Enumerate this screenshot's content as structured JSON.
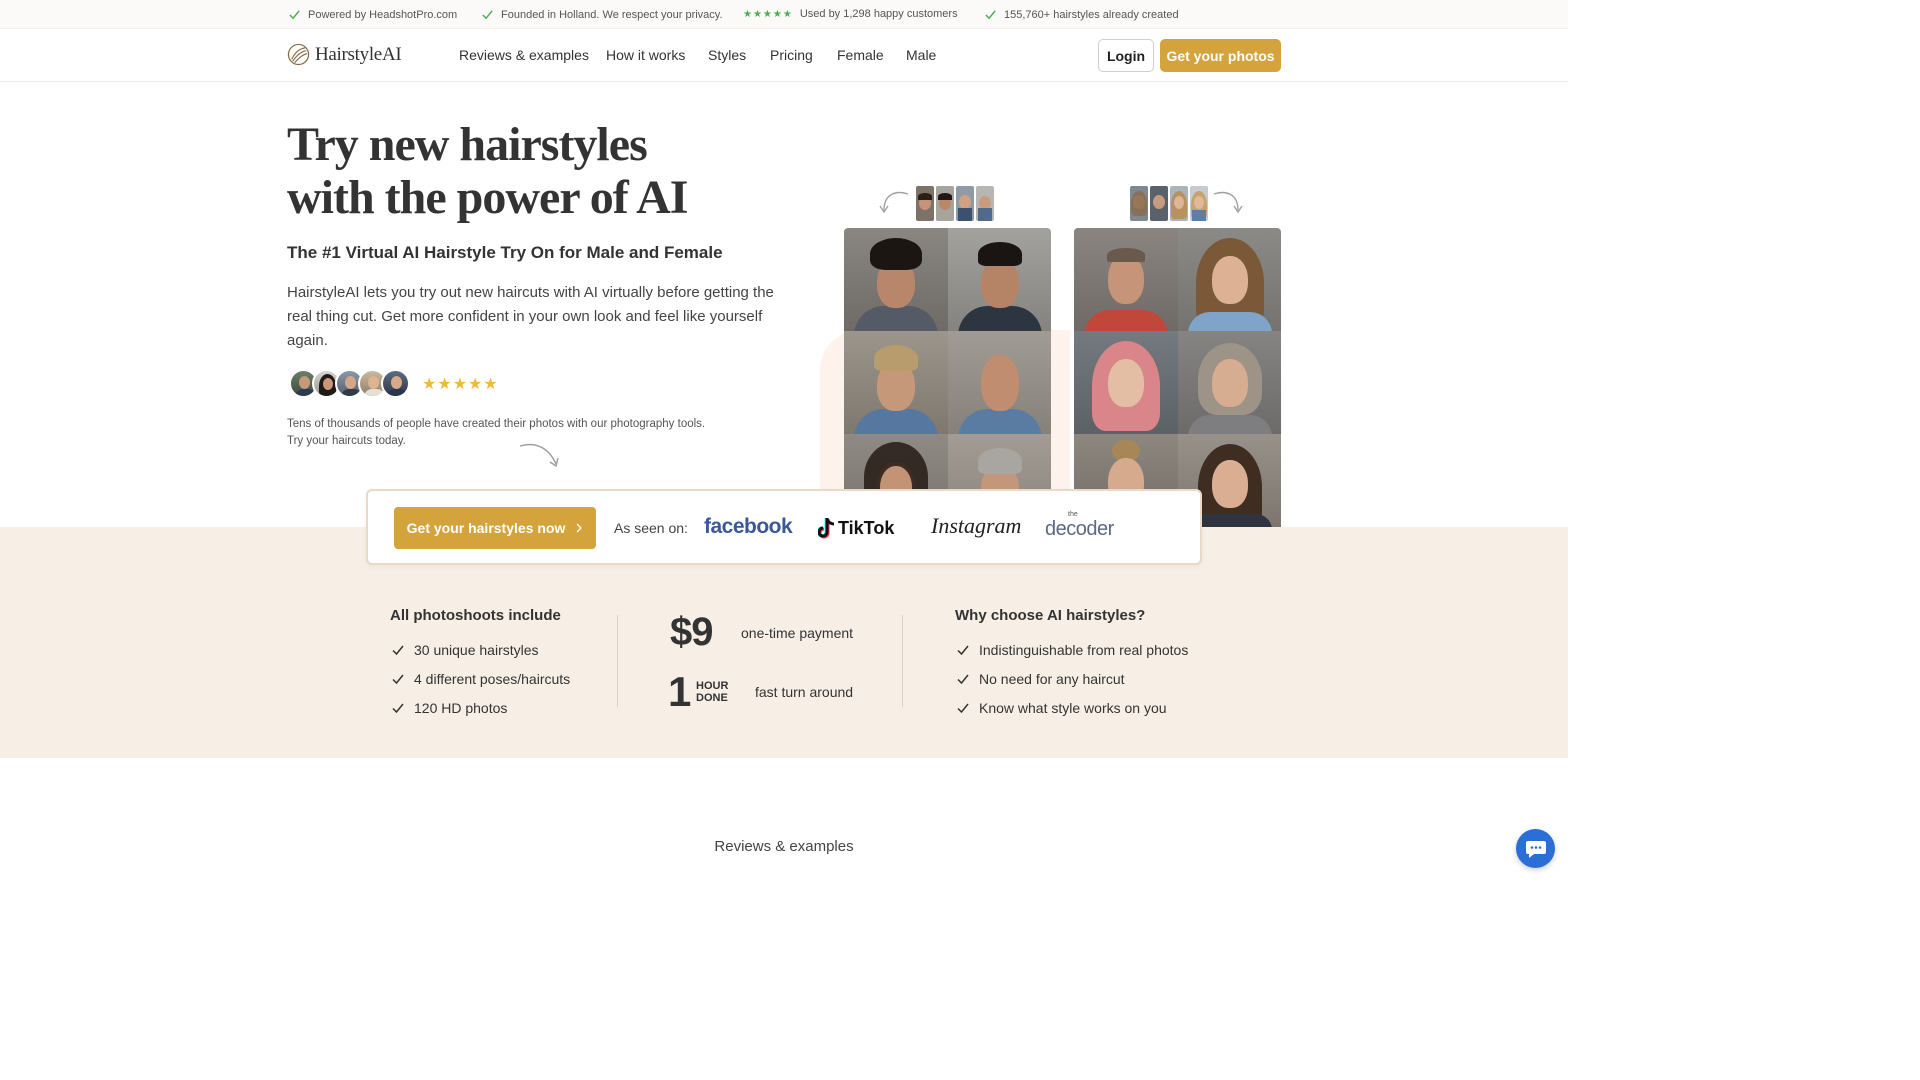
{
  "topbar": {
    "items": [
      {
        "text": "Powered by HeadshotPro.com",
        "icon": "check-icon"
      },
      {
        "text": "Founded in Holland. We respect your privacy.",
        "icon": "check-icon"
      },
      {
        "text": "Used by 1,298 happy customers",
        "icon": "stars-icon",
        "stars": "★★★★★"
      },
      {
        "text": "155,760+ hairstyles already created",
        "icon": "check-icon"
      }
    ]
  },
  "nav": {
    "logo_text": "HairstyleAI",
    "links": [
      "Reviews & examples",
      "How it works",
      "Styles",
      "Pricing",
      "Female",
      "Male"
    ],
    "login_label": "Login",
    "cta_label": "Get your photos"
  },
  "hero": {
    "title_line1": "Try new hairstyles",
    "title_line2": "with the power of AI",
    "subtitle": "The #1 Virtual AI Hairstyle Try On for Male and Female",
    "body": "HairstyleAI lets you try out new haircuts with AI virtually before getting the real thing cut. Get more confident in your own look and feel like yourself again.",
    "stars": "★★★★★",
    "note": "Tens of thousands of people have created their photos with our photography tools. Try your haircuts today."
  },
  "seen_on": {
    "cta_label": "Get your hairstyles now",
    "label": "As seen on:",
    "brands": [
      "facebook",
      "TikTok",
      "Instagram",
      "decoder"
    ],
    "decoder_prefix": "the"
  },
  "features": {
    "col1_title": "All photoshoots include",
    "col1_items": [
      "30 unique hairstyles",
      "4 different poses/haircuts",
      "120 HD photos"
    ],
    "price": "$9",
    "price_label": "one-time payment",
    "turnaround_number": "1",
    "turnaround_unit_line1": "HOUR",
    "turnaround_unit_line2": "DONE",
    "turnaround_label": "fast turn around",
    "col3_title": "Why choose AI hairstyles?",
    "col3_items": [
      "Indistinguishable from real photos",
      "No need for any haircut",
      "Know what style works on you"
    ]
  },
  "reviews_heading": "Reviews & examples",
  "colors": {
    "accent": "#d4a33b",
    "beige": "#f7efe6",
    "check_green": "#4caf50",
    "chat_blue": "#2a6fd6"
  }
}
